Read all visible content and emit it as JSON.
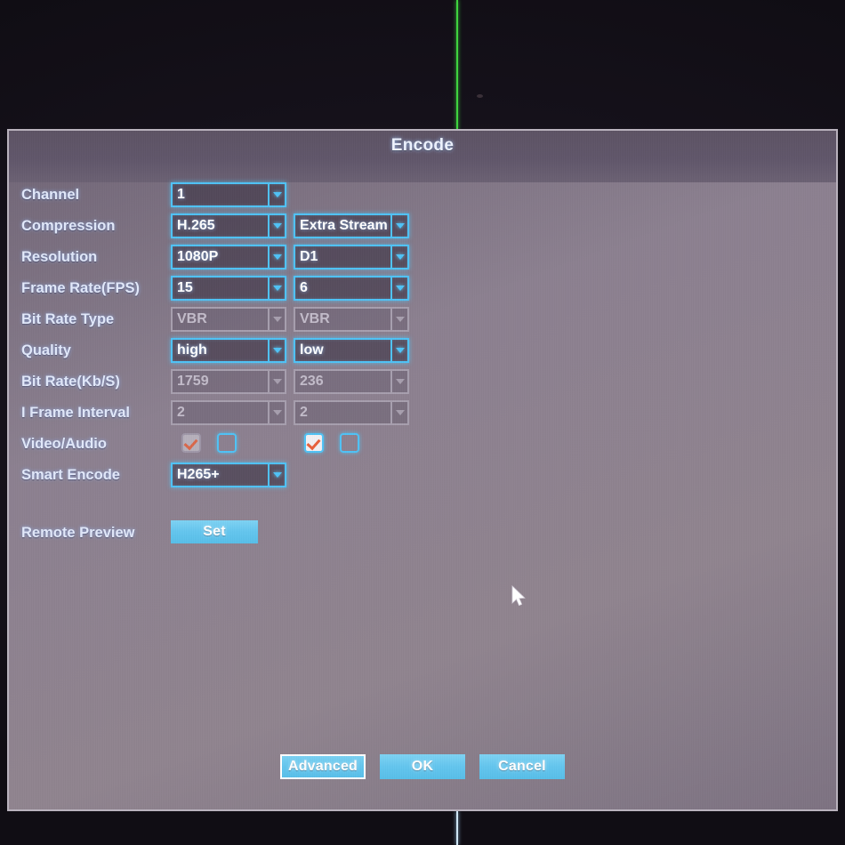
{
  "dialog": {
    "title": "Encode"
  },
  "rows": [
    {
      "label": "Channel",
      "main": {
        "value": "1",
        "disabled": false
      },
      "extra": null
    },
    {
      "label": "Compression",
      "main": {
        "value": "H.265",
        "disabled": false
      },
      "extra": {
        "value": "Extra Stream",
        "disabled": false
      }
    },
    {
      "label": "Resolution",
      "main": {
        "value": "1080P",
        "disabled": false
      },
      "extra": {
        "value": "D1",
        "disabled": false
      }
    },
    {
      "label": "Frame Rate(FPS)",
      "main": {
        "value": "15",
        "disabled": false
      },
      "extra": {
        "value": "6",
        "disabled": false
      }
    },
    {
      "label": "Bit Rate Type",
      "main": {
        "value": "VBR",
        "disabled": true
      },
      "extra": {
        "value": "VBR",
        "disabled": true
      }
    },
    {
      "label": "Quality",
      "main": {
        "value": "high",
        "disabled": false
      },
      "extra": {
        "value": "low",
        "disabled": false
      }
    },
    {
      "label": "Bit Rate(Kb/S)",
      "main": {
        "value": "1759",
        "disabled": true
      },
      "extra": {
        "value": "236",
        "disabled": true
      }
    },
    {
      "label": "I Frame Interval",
      "main": {
        "value": "2",
        "disabled": true
      },
      "extra": {
        "value": "2",
        "disabled": true
      }
    }
  ],
  "video_audio": {
    "label": "Video/Audio",
    "main_video": {
      "checked": true,
      "disabled": true
    },
    "main_audio": {
      "checked": false,
      "disabled": false
    },
    "extra_video": {
      "checked": true,
      "disabled": false
    },
    "extra_audio": {
      "checked": false,
      "disabled": false
    }
  },
  "smart_encode": {
    "label": "Smart Encode",
    "value": "H265+"
  },
  "remote_preview": {
    "label": "Remote Preview",
    "button": "Set"
  },
  "footer": {
    "advanced": "Advanced",
    "ok": "OK",
    "cancel": "Cancel"
  },
  "colors": {
    "accent_cyan": "#4fc3f7",
    "button_blue": "#63c6ef",
    "panel": "#8c8090",
    "label_text": "#e2e9fb",
    "check_mark": "#e8603c",
    "green_line": "#3fd43f"
  }
}
